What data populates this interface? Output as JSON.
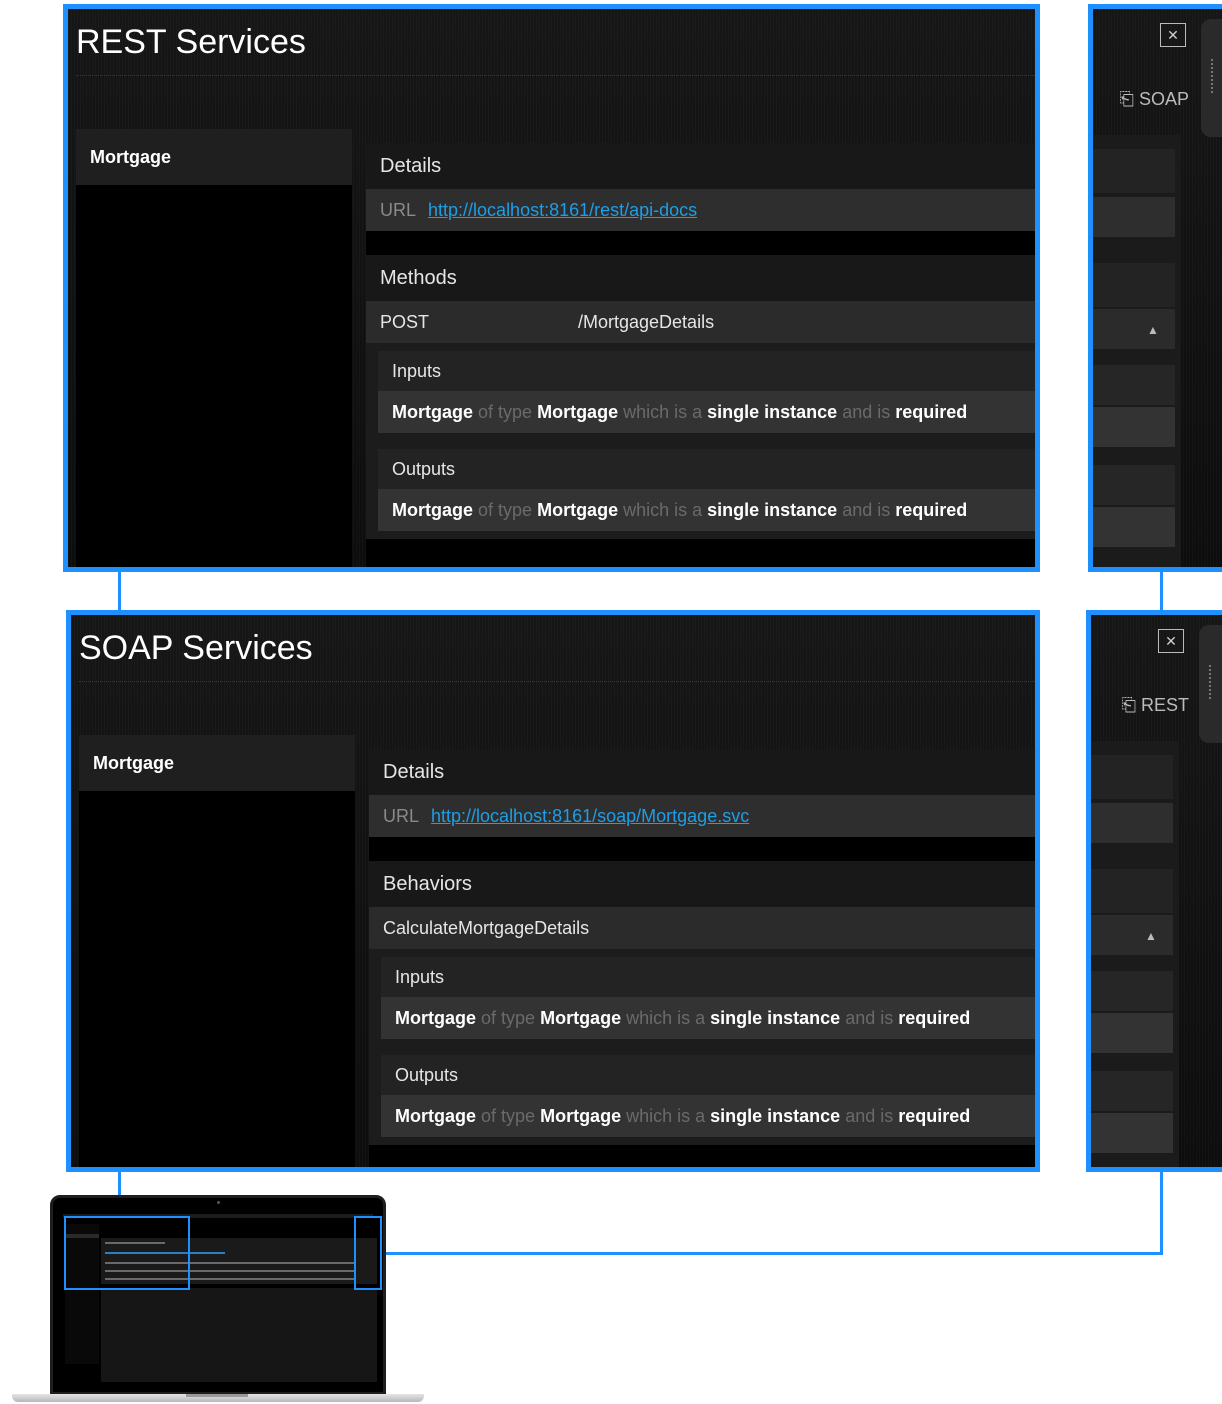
{
  "rest_panel": {
    "title": "REST Services",
    "service_item": "Mortgage",
    "details_header": "Details",
    "url_label": "URL",
    "url_value": "http://localhost:8161/rest/api-docs",
    "methods_header": "Methods",
    "method_verb": "POST",
    "method_path": "/MortgageDetails",
    "inputs_header": "Inputs",
    "outputs_header": "Outputs",
    "input_param": {
      "name": "Mortgage",
      "of_type": "of type",
      "type": "Mortgage",
      "which_is_a": "which is a",
      "multiplicity": "single instance",
      "and_is": "and is",
      "requirement": "required"
    },
    "output_param": {
      "name": "Mortgage",
      "of_type": "of type",
      "type": "Mortgage",
      "which_is_a": "which is a",
      "multiplicity": "single instance",
      "and_is": "and is",
      "requirement": "required"
    }
  },
  "soap_panel": {
    "title": "SOAP Services",
    "service_item": "Mortgage",
    "details_header": "Details",
    "url_label": "URL",
    "url_value": "http://localhost:8161/soap/Mortgage.svc",
    "behaviors_header": "Behaviors",
    "behavior_name": "CalculateMortgageDetails",
    "inputs_header": "Inputs",
    "outputs_header": "Outputs",
    "input_param": {
      "name": "Mortgage",
      "of_type": "of type",
      "type": "Mortgage",
      "which_is_a": "which is a",
      "multiplicity": "single instance",
      "and_is": "and is",
      "requirement": "required"
    },
    "output_param": {
      "name": "Mortgage",
      "of_type": "of type",
      "type": "Mortgage",
      "which_is_a": "which is a",
      "multiplicity": "single instance",
      "and_is": "and is",
      "requirement": "required"
    }
  },
  "rest_side": {
    "close_glyph": "✕",
    "switch_label": "SOAP",
    "caret": "▲"
  },
  "soap_side": {
    "close_glyph": "✕",
    "switch_label": "REST",
    "caret": "▲"
  },
  "icons": {
    "switch_icon": "export-icon",
    "close_icon": "close-icon",
    "collapse_icon": "caret-up-icon"
  },
  "colors": {
    "highlight_border": "#1e90ff",
    "link": "#1e9ee6",
    "background": "#0b0b0b"
  }
}
